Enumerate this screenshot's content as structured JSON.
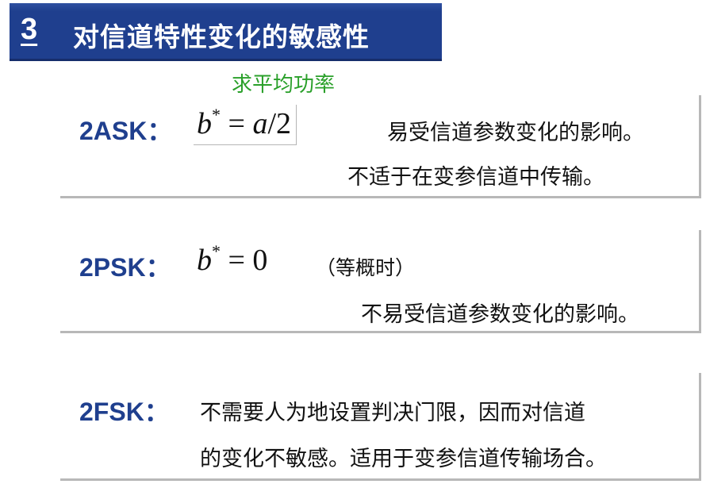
{
  "header": {
    "number": "3",
    "title": "对信道特性变化的敏感性"
  },
  "annotation": "求平均功率",
  "ask": {
    "label": "2ASK：",
    "formula_var": "b",
    "formula_sup": "*",
    "formula_rhs_pre": " = ",
    "formula_rhs_var": "a",
    "formula_rhs_post": "/2",
    "line1": "易受信道参数变化的影响。",
    "line2": "不适于在变参信道中传输。"
  },
  "psk": {
    "label": "2PSK：",
    "formula_var": "b",
    "formula_sup": "*",
    "formula_rhs": " = 0",
    "note": "（等概时）",
    "line1": "不易受信道参数变化的影响。"
  },
  "fsk": {
    "label": "2FSK：",
    "line1": "不需要人为地设置判决门限，因而对信道",
    "line2": "的变化不敏感。适用于变参信道传输场合。"
  }
}
